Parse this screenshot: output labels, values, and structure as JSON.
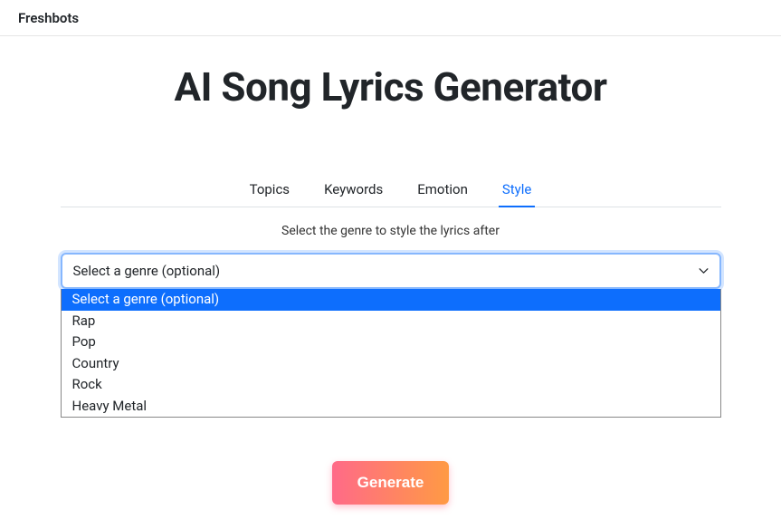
{
  "header": {
    "brand": "Freshbots"
  },
  "page": {
    "title": "AI Song Lyrics Generator"
  },
  "tabs": [
    {
      "label": "Topics",
      "active": false
    },
    {
      "label": "Keywords",
      "active": false
    },
    {
      "label": "Emotion",
      "active": false
    },
    {
      "label": "Style",
      "active": true
    }
  ],
  "instruction": "Select the genre to style the lyrics after",
  "select": {
    "value": "Select a genre (optional)",
    "options": [
      "Select a genre (optional)",
      "Rap",
      "Pop",
      "Country",
      "Rock",
      "Heavy Metal"
    ]
  },
  "generate": {
    "label": "Generate"
  }
}
